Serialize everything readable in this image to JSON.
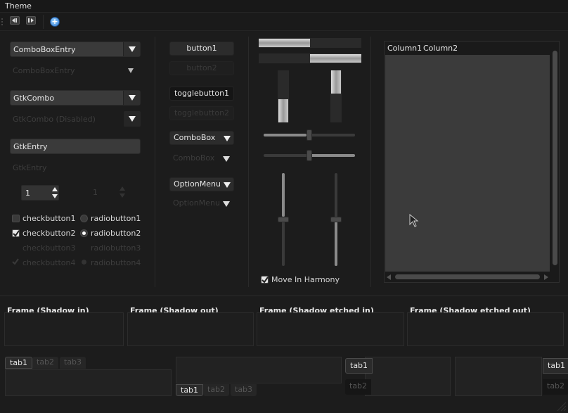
{
  "menubar": {
    "theme": "Theme"
  },
  "toolbar": {
    "buttons": [
      "go-first-icon",
      "go-last-icon",
      "add-icon"
    ]
  },
  "left": {
    "combobox_entry": "ComboBoxEntry",
    "combobox_entry_disabled": "ComboBoxEntry",
    "gtk_combo": "GtkCombo",
    "gtk_combo_disabled": "GtkCombo (Disabled)",
    "gtk_entry": "GtkEntry",
    "gtk_entry_disabled": "GtkEntry",
    "spin_value": "1",
    "spin_value_disabled": "1",
    "checks": [
      "checkbutton1",
      "checkbutton2",
      "checkbutton3",
      "checkbutton4"
    ],
    "radios": [
      "radiobutton1",
      "radiobutton2",
      "radiobutton3",
      "radiobutton4"
    ]
  },
  "middle": {
    "button1": "button1",
    "button2": "button2",
    "togglebutton1": "togglebutton1",
    "togglebutton2": "togglebutton2",
    "combobox": "ComboBox",
    "combobox_disabled": "ComboBox",
    "optionmenu": "OptionMenu",
    "optionmenu_disabled": "OptionMenu"
  },
  "progress": {
    "h_top_fraction": 0.5,
    "h_bottom_fraction": 0.5,
    "v_left_fraction": 0.45,
    "v_right_fraction": 0.45,
    "hscale_top_value": 0.5,
    "hscale_bottom_value": 0.5,
    "vscale_left_value": 0.5,
    "vscale_right_value": 0.5,
    "harmony_label": "Move In Harmony"
  },
  "tree": {
    "columns": [
      "Column1",
      "Column2"
    ]
  },
  "frames": [
    "Frame (Shadow in)",
    "Frame (Shadow out)",
    "Frame (Shadow etched in)",
    "Frame (Shadow etched out)"
  ],
  "notebooks": {
    "tabs": [
      "tab1",
      "tab2",
      "tab3"
    ],
    "side_tabs": [
      "tab1",
      "tab2"
    ]
  },
  "colors": {
    "background": "#1c1c1c",
    "widget": "#3a3a3a",
    "text": "#e6e6e6",
    "disabled_text": "#3d3d3d"
  }
}
